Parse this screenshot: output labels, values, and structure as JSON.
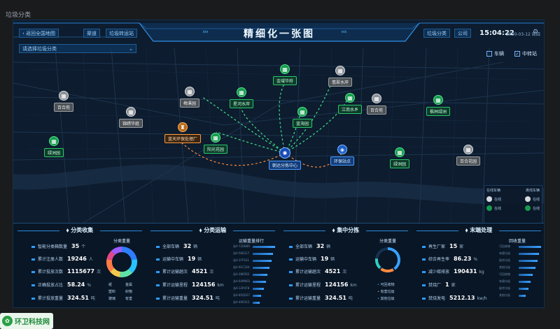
{
  "page": {
    "caption": "垃圾分类"
  },
  "header": {
    "back_label": "返回全国地图",
    "district_selector": "请选择垃圾分类",
    "tab_left_1": "渠道",
    "tab_left_2": "垃圾转运站",
    "title": "精细化一张图",
    "tab_right_1": "垃圾分类",
    "tab_right_2": "公司",
    "clock": "15:04:22",
    "date": "2020-03-12  周四",
    "settings_icon": "gear-icon"
  },
  "layers": {
    "vehicle": {
      "label": "车辆",
      "checked": false
    },
    "transfer": {
      "label": "中转站",
      "checked": true
    }
  },
  "map": {
    "center": {
      "label": "朝达分拣中心",
      "kind": "center"
    },
    "nodes": [
      {
        "label": "百合苑",
        "kind": "w"
      },
      {
        "label": "锦绣华庭",
        "kind": "w"
      },
      {
        "label": "绿洲园",
        "kind": "g"
      },
      {
        "label": "梅溪园",
        "kind": "w"
      },
      {
        "label": "星河水岸",
        "kind": "g"
      },
      {
        "label": "金域华府",
        "kind": "g"
      },
      {
        "label": "紫荆花园",
        "kind": "g"
      },
      {
        "label": "蓝海园",
        "kind": "g"
      },
      {
        "label": "翡翠水岸",
        "kind": "w"
      },
      {
        "label": "江南水乡",
        "kind": "g"
      },
      {
        "label": "百合苑",
        "kind": "w"
      },
      {
        "label": "枫林绿洲",
        "kind": "g"
      },
      {
        "label": "蓝天环保处理厂",
        "kind": "o"
      },
      {
        "label": "阳光花园",
        "kind": "g"
      },
      {
        "label": "环保站点",
        "kind": "b"
      },
      {
        "label": "绿洲园",
        "kind": "g"
      },
      {
        "label": "百合花园",
        "kind": "w"
      }
    ]
  },
  "status_panel": {
    "col1_title": "在线车辆",
    "col2_title": "离线车辆",
    "rows": [
      {
        "label": "在线",
        "value": "",
        "color": "#d6dbe0"
      },
      {
        "label": "在线",
        "value": "",
        "color": "#169c4f"
      },
      {
        "label": "在线",
        "value": "",
        "color": "#d6dbe0"
      },
      {
        "label": "在线",
        "value": "",
        "color": "#169c4f"
      }
    ]
  },
  "sections": {
    "collect": {
      "title": "分类收集",
      "stats": [
        {
          "label": "智能分类箱数量",
          "value": "35",
          "unit": "个"
        },
        {
          "label": "累计注册人数",
          "value": "19246",
          "unit": "人"
        },
        {
          "label": "累计投放次数",
          "value": "1115677",
          "unit": "次"
        },
        {
          "label": "正确投放占比",
          "value": "58.24",
          "unit": "%"
        },
        {
          "label": "累计投放重量",
          "value": "324.51",
          "unit": "吨"
        }
      ],
      "chart_title": "分类重量",
      "legend": [
        "纸",
        "金属",
        "塑料",
        "织物",
        "玻璃",
        "有害"
      ]
    },
    "transport": {
      "title": "分类运输",
      "stats": [
        {
          "label": "全部车辆",
          "value": "32",
          "unit": "辆"
        },
        {
          "label": "运输中车辆",
          "value": "19",
          "unit": "辆"
        },
        {
          "label": "累计运输趟次",
          "value": "4521",
          "unit": "次"
        },
        {
          "label": "累计运输里程",
          "value": "124156",
          "unit": "km"
        },
        {
          "label": "累计运输重量",
          "value": "324.51",
          "unit": "吨"
        }
      ],
      "chart_title": "运输重量排行",
      "bars": [
        {
          "name": "浙A·72D889",
          "value": 0.95
        },
        {
          "name": "浙A·56E217",
          "value": 0.85
        },
        {
          "name": "浙A·37F631",
          "value": 0.78
        },
        {
          "name": "浙A·91C104",
          "value": 0.7
        },
        {
          "name": "浙A·28K562",
          "value": 0.62
        },
        {
          "name": "浙A·64M903",
          "value": 0.55
        },
        {
          "name": "浙A·13P478",
          "value": 0.46
        },
        {
          "name": "浙A·85Q027",
          "value": 0.36
        },
        {
          "name": "浙A·40R315",
          "value": 0.28
        }
      ]
    },
    "sorting": {
      "title": "集中分拣",
      "stats": [
        {
          "label": "全部车辆",
          "value": "32",
          "unit": "辆"
        },
        {
          "label": "运输中车辆",
          "value": "19",
          "unit": "辆"
        },
        {
          "label": "累计运输趟次",
          "value": "4521",
          "unit": "次"
        },
        {
          "label": "累计运输里程",
          "value": "124156",
          "unit": "km"
        },
        {
          "label": "累计运输重量",
          "value": "324.51",
          "unit": "吨"
        }
      ],
      "chart_title": "分类重量",
      "legend": [
        "可回收物",
        "有害垃圾",
        "其他垃圾"
      ]
    },
    "final": {
      "title": "末端处理",
      "stats": [
        {
          "label": "再生厂家",
          "value": "15",
          "unit": "家"
        },
        {
          "label": "综合再生率",
          "value": "86.23",
          "unit": "%"
        },
        {
          "label": "减少碳排放",
          "value": "190431",
          "unit": "kg"
        },
        {
          "label": "焚烧厂",
          "value": "1",
          "unit": "家"
        },
        {
          "label": "焚烧发电",
          "value": "5212.13",
          "unit": "kw/h"
        }
      ],
      "chart_title": "回收重量",
      "bars": [
        {
          "name": "可回收物",
          "value": 0.95
        },
        {
          "name": "有害垃圾",
          "value": 0.86
        },
        {
          "name": "厨余垃圾",
          "value": 0.78
        },
        {
          "name": "其他垃圾",
          "value": 0.7
        },
        {
          "name": "可回收物",
          "value": 0.6
        },
        {
          "name": "有害垃圾",
          "value": 0.5
        },
        {
          "name": "厨余垃圾",
          "value": 0.4
        },
        {
          "name": "其他垃圾",
          "value": 0.3
        }
      ]
    }
  },
  "donut": {
    "segments": [
      {
        "color": "#2f7dff",
        "value": 22
      },
      {
        "color": "#28c2ff",
        "value": 16
      },
      {
        "color": "#5fe0a8",
        "value": 14
      },
      {
        "color": "#f2c94c",
        "value": 12
      },
      {
        "color": "#ff7a45",
        "value": 14
      },
      {
        "color": "#e0468a",
        "value": 10
      },
      {
        "color": "#9b5cff",
        "value": 12
      }
    ]
  },
  "sort_gauge": {
    "colors": [
      "#3aa0ff",
      "#ff8a3d",
      "#2fd0c0"
    ],
    "fraction": 0.72
  },
  "watermark": {
    "text": "环卫科技网"
  }
}
